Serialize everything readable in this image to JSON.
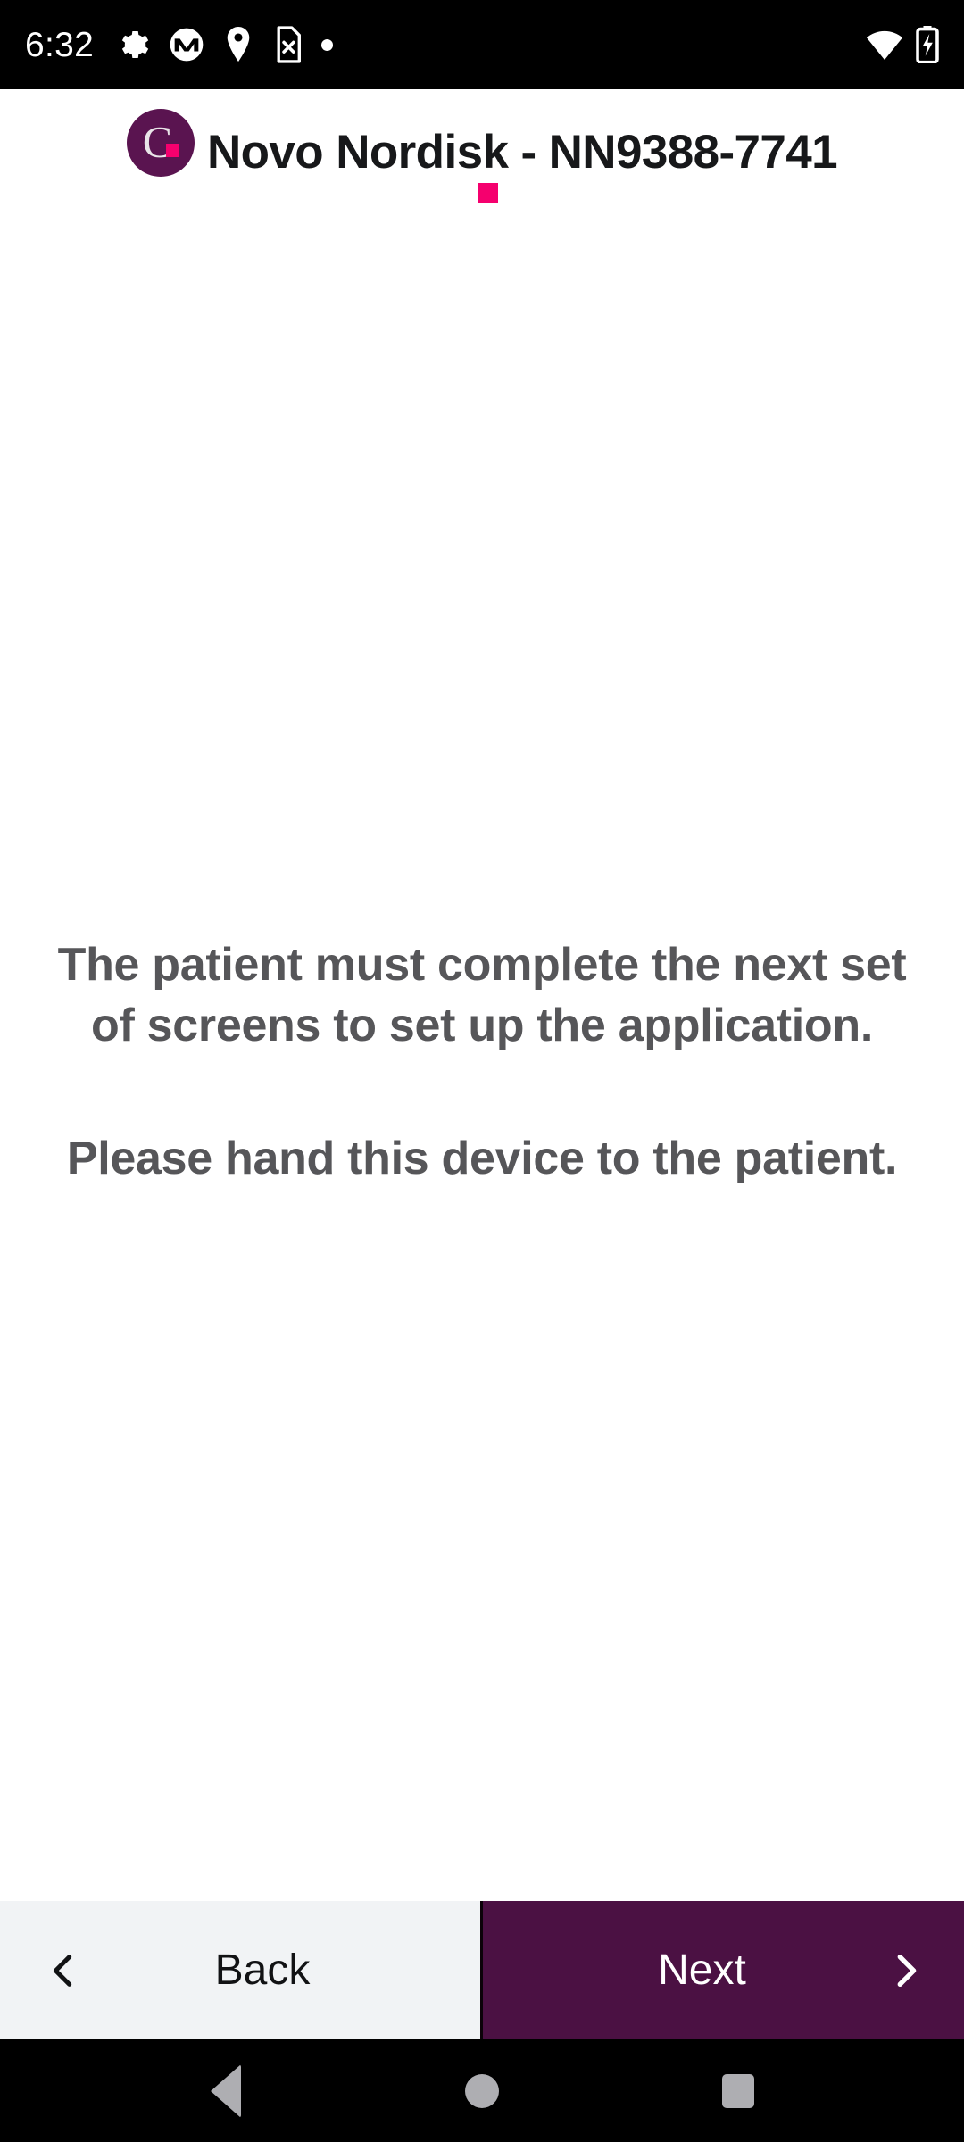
{
  "status_bar": {
    "time": "6:32",
    "left_icons": [
      {
        "name": "settings-gear-icon",
        "glyph": "gear"
      },
      {
        "name": "motorola-logo-icon",
        "glyph": "motorola-m"
      },
      {
        "name": "location-pin-icon",
        "glyph": "pin"
      },
      {
        "name": "no-sim-card-icon",
        "glyph": "sim-x"
      },
      {
        "name": "notification-dot-icon",
        "glyph": "dot"
      }
    ],
    "right_icons": [
      {
        "name": "wifi-icon",
        "glyph": "wifi"
      },
      {
        "name": "battery-charging-icon",
        "glyph": "battery-bolt"
      }
    ],
    "background_color": "#000000",
    "foreground_color": "#ffffff"
  },
  "header": {
    "logo_letter": "C",
    "logo_background_color": "#5a1450",
    "accent_color": "#f5006e",
    "title": "Novo Nordisk - NN9388-7741"
  },
  "main": {
    "paragraph_1": "The patient must complete the next set of screens to set up the application.",
    "paragraph_2": "Please hand this device to the patient.",
    "text_color": "#565659",
    "background_color": "#ffffff"
  },
  "footer": {
    "back_label": "Back",
    "next_label": "Next",
    "back_background_color": "#f1f3f5",
    "next_background_color": "#4b1143",
    "back_icon": "chevron-left-icon",
    "next_icon": "chevron-right-icon"
  },
  "system_nav": {
    "back": "back-triangle",
    "home": "home-circle",
    "recents": "recents-square",
    "background_color": "#000000",
    "icon_color": "#aeaeb2"
  }
}
